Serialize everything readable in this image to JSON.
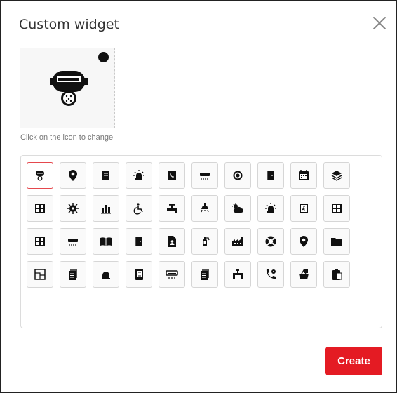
{
  "dialog": {
    "title": "Custom widget",
    "hint": "Click on the icon to change",
    "create_label": "Create"
  },
  "colors": {
    "accent": "#e41b23",
    "selected_border": "#e5484d"
  },
  "icons": [
    [
      "welding-mask-icon",
      "map-pin-icon",
      "notebook-icon",
      "siren-icon",
      "phone-book-icon",
      "air-conditioner-icon",
      "gear-badge-icon",
      "door-icon",
      "calendar-icon",
      "layers-icon"
    ],
    [
      "window-icon",
      "virus-icon",
      "city-skyline-icon",
      "wheelchair-icon",
      "valve-icon",
      "ceiling-lamp-icon",
      "partly-cloudy-icon",
      "alarm-light-icon",
      "emergency-exit-icon",
      "window-frame-icon"
    ],
    [
      "window-grid-icon",
      "split-ac-icon",
      "open-book-icon",
      "door-open-icon",
      "document-user-icon",
      "fire-extinguisher-icon",
      "factory-icon",
      "lifebuoy-icon",
      "location-pin-icon",
      "folder-icon"
    ],
    [
      "blueprint-icon",
      "documents-icon",
      "bell-alarm-icon",
      "address-book-icon",
      "ac-vent-icon",
      "file-stack-icon",
      "pipe-valve-icon",
      "phone-settings-icon",
      "basket-icon",
      "clipboard-icon"
    ]
  ]
}
